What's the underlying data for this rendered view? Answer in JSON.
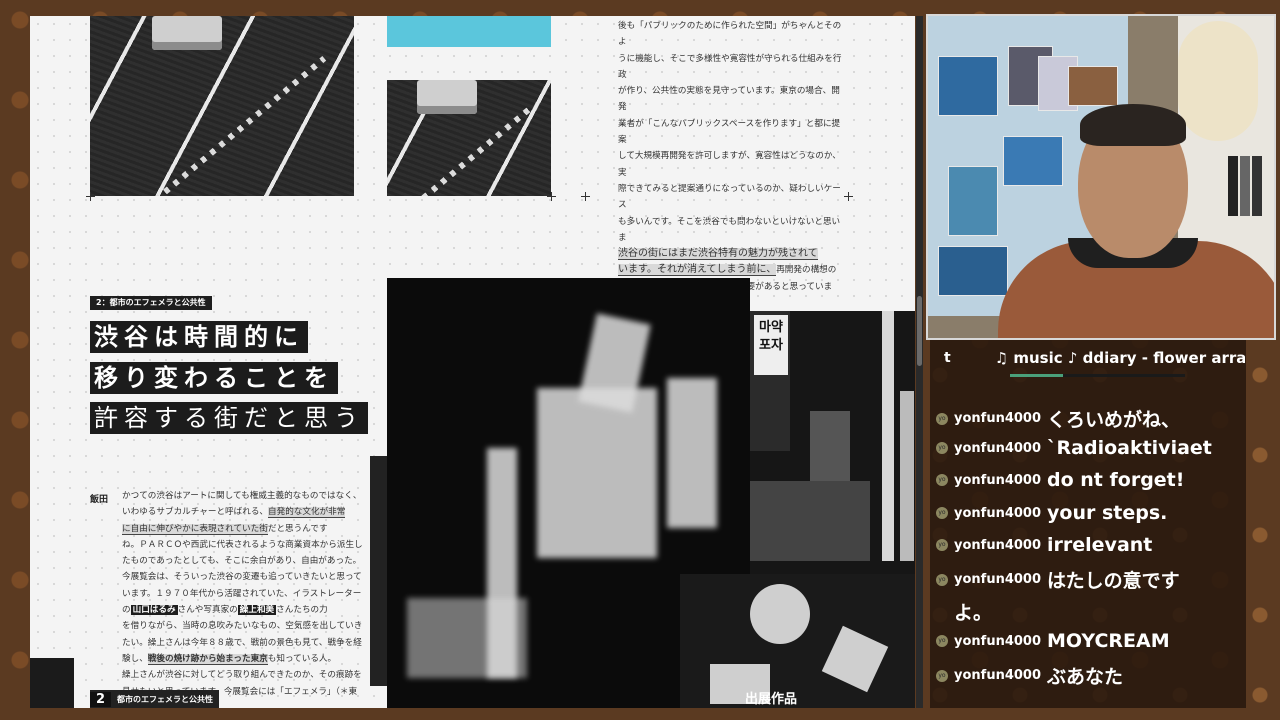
{
  "document": {
    "top_right_text_lines": [
      "後も「パブリックのために作られた空間」がちゃんとそのよ",
      "うに機能し、そこで多様性や寛容性が守られる仕組みを行政",
      "が作り、公共性の実態を見守っています。東京の場合、開発",
      "業者が「こんなパブリックスペースを作ります」と都に提案",
      "して大規模再開発を許可しますが、寛容性はどうなのか、実",
      "際できてみると提案通りになっているのか、疑わしいケース",
      "も多いんです。そこを渋谷でも問わないといけないと思いま",
      "渋谷の街にはまだ渋谷特有の魅力が残されて",
      "います。それが消えてしまう前に、",
      "再開発の構想の",
      "しかたや進め方を議論していく必要があると思っています。"
    ],
    "section_tag": "2：都市のエフェメラと公共性",
    "headline": [
      "渋谷は時間的に",
      "移り変わることを",
      "許容する街だと思う"
    ],
    "speaker": "飯田",
    "body_lines": [
      "かつての渋谷はアートに関しても権威主義的なものではなく、",
      "いわゆるサブカルチャーと呼ばれる、",
      "自発的な文化が非常",
      "に自由に伸びやかに表現されていた街",
      "だと思うんです",
      "ね。ＰＡＲＣＯや西武に代表されるような商業資本から派生し",
      "たものであったとしても、そこに余白があり、自由があった。",
      "今展覧会は、そういった渋谷の変遷も追っていきたいと思って",
      "います。１９７０年代から活躍されていた、イラストレーター",
      "の",
      "山口はるみ",
      "さんや写真家の",
      "繰上和美",
      "さんたちの力",
      "を借りながら、当時の息吹みたいなもの、空気感を出していき",
      "たい。繰上さんは今年８８歳で、戦前の景色も見て、戦争を経",
      "験し、",
      "戦後の焼け跡から始まった東京",
      "も知っている人。",
      "繰上さんが渋谷に対してどう取り組んできたのか、その痕跡を",
      "見せたいと思っています。今展覧会には「エフェメラ」（＊東"
    ],
    "ribbon_number": "2",
    "ribbon_label": "都市のエフェメラと公共性",
    "photo_caption": "出展作品",
    "sign_text": "마약\n포자"
  },
  "chat": {
    "music_prefix": "t",
    "music_track": "♫ music ♪ ddiary - flower arra",
    "music_progress": 0.3,
    "messages": [
      {
        "user": "yonfun4000",
        "text": "くろいめがね、"
      },
      {
        "user": "yonfun4000",
        "text": "`Radioaktiviaet"
      },
      {
        "user": "yonfun4000",
        "text": "do nt forget!"
      },
      {
        "user": "yonfun4000",
        "text": "your steps."
      },
      {
        "user": "yonfun4000",
        "text": "irrelevant"
      },
      {
        "user": "yonfun4000",
        "text": "はたしの意です"
      },
      {
        "user": "",
        "text": "よ。"
      },
      {
        "user": "yonfun4000",
        "text": "MOYCREAM"
      },
      {
        "user": "yonfun4000",
        "text": "ぶあなた"
      }
    ],
    "badge_label": "yo"
  },
  "colors": {
    "accent_cyan": "#5bc6dc",
    "chat_bg": "#28180e",
    "progress_green": "#4aa07a"
  }
}
